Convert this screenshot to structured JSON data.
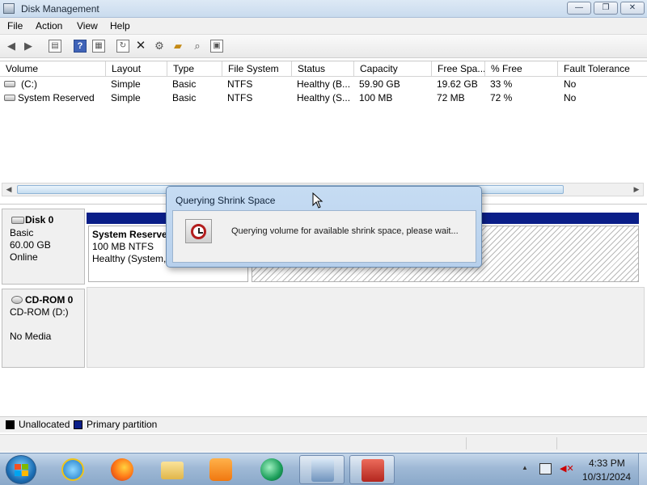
{
  "window": {
    "title": "Disk Management",
    "controls": {
      "minimize": "—",
      "maximize": "❐",
      "close": "✕"
    }
  },
  "menu": [
    "File",
    "Action",
    "View",
    "Help"
  ],
  "toolbar": {
    "icons": [
      "back-arrow-icon",
      "forward-arrow-icon",
      "console-tree-icon",
      "help-icon",
      "properties-icon",
      "refresh-icon",
      "delete-icon",
      "settings-icon",
      "open-folder-icon",
      "search-icon",
      "export-icon"
    ]
  },
  "volumes": {
    "columns": [
      "Volume",
      "Layout",
      "Type",
      "File System",
      "Status",
      "Capacity",
      "Free Spa...",
      "% Free",
      "Fault Tolerance"
    ],
    "rows": [
      {
        "volume": "(C:)",
        "layout": "Simple",
        "type": "Basic",
        "fs": "NTFS",
        "status": "Healthy (B...",
        "capacity": "59.90 GB",
        "free": "19.62 GB",
        "pct_free": "33 %",
        "fault": "No"
      },
      {
        "volume": "System Reserved",
        "layout": "Simple",
        "type": "Basic",
        "fs": "NTFS",
        "status": "Healthy (S...",
        "capacity": "100 MB",
        "free": "72 MB",
        "pct_free": "72 %",
        "fault": "No"
      }
    ]
  },
  "disks": {
    "disk0": {
      "name": "Disk 0",
      "type": "Basic",
      "size": "60.00 GB",
      "state": "Online"
    },
    "partition": {
      "name": "System Reserve",
      "size": "100 MB NTFS",
      "status": "Healthy (System,"
    },
    "cdrom": {
      "name": "CD-ROM 0",
      "drive": "CD-ROM (D:)",
      "media": "No Media"
    }
  },
  "legend": {
    "items": [
      {
        "label": "Unallocated",
        "color": "#000000"
      },
      {
        "label": "Primary partition",
        "color": "#0a1e88"
      }
    ]
  },
  "dialog": {
    "title": "Querying Shrink Space",
    "message": "Querying volume for available shrink space, please wait..."
  },
  "taskbar": {
    "time": "4:33 PM",
    "date": "10/31/2024",
    "apps": [
      "internet-explorer-icon",
      "firefox-icon",
      "file-explorer-icon",
      "media-player-icon",
      "green-app-icon",
      "computer-management-icon",
      "toolbox-icon"
    ]
  }
}
